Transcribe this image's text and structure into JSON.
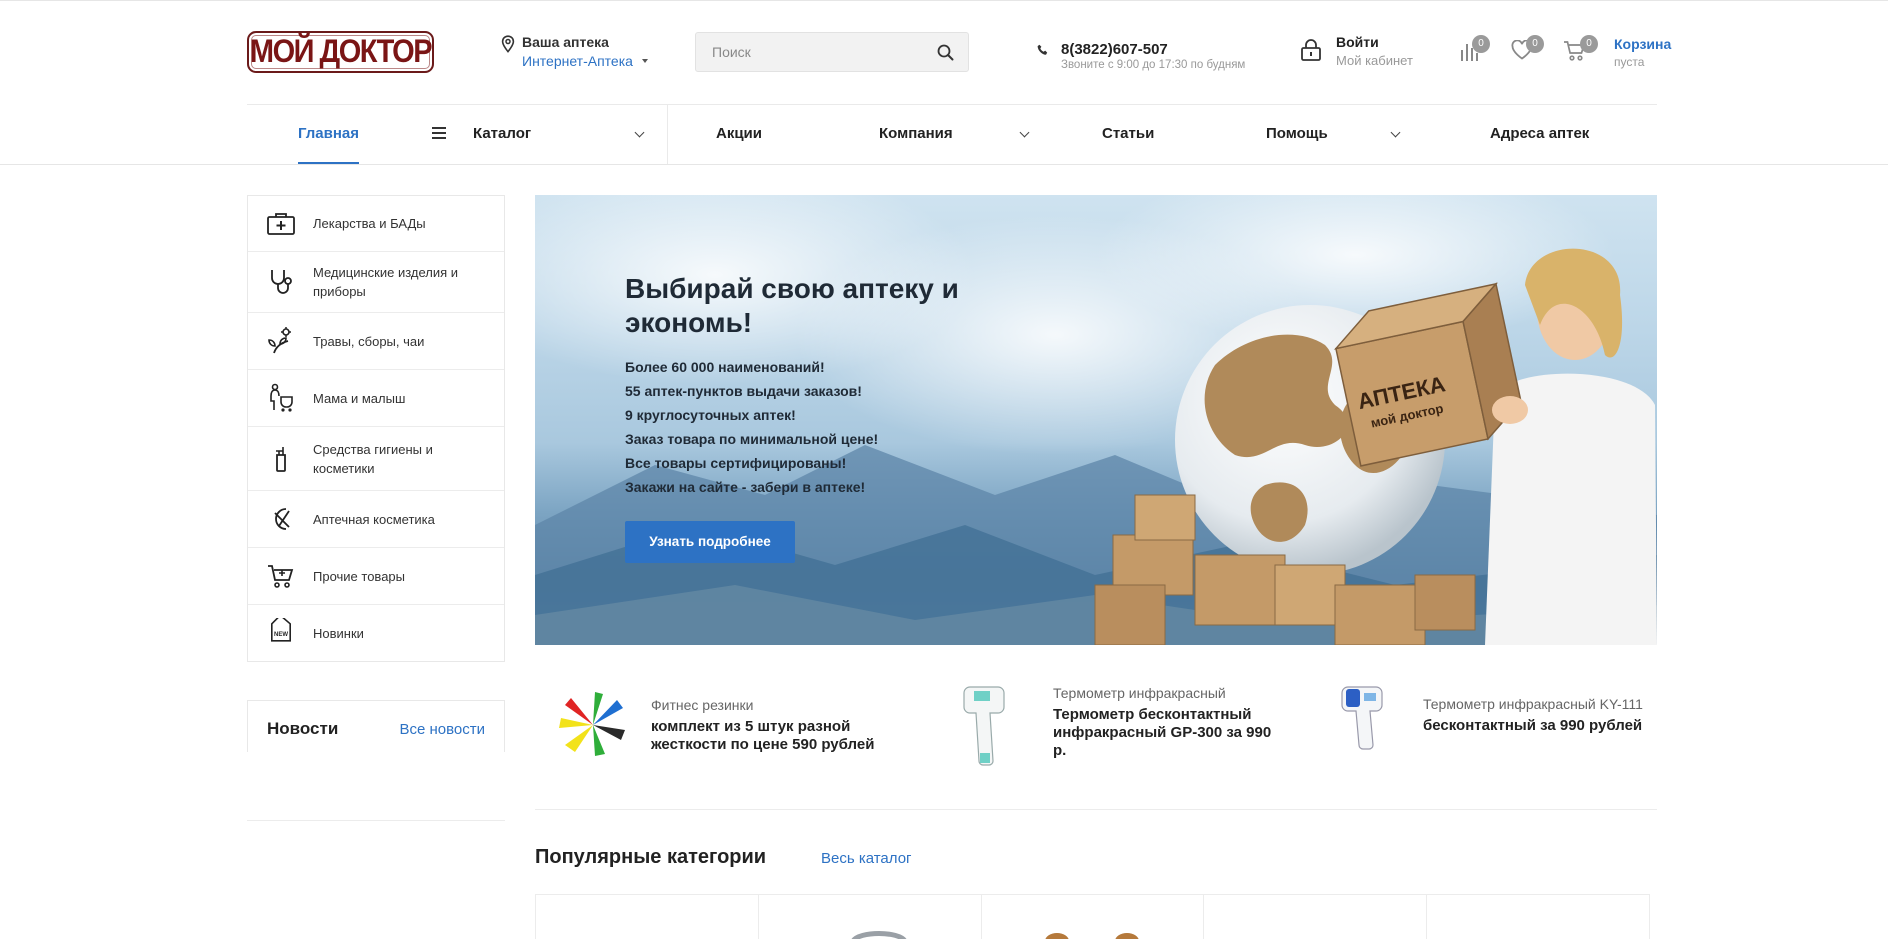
{
  "header": {
    "logo_text": "МОЙ ДОКТОР",
    "pharmacy_label": "Ваша аптека",
    "pharmacy_value": "Интернет-Аптека",
    "search_placeholder": "Поиск",
    "phone_number": "8(3822)607-507",
    "phone_hint": "Звоните с 9:00 до 17:30 по будням",
    "login_title": "Войти",
    "login_subtitle": "Мой кабинет",
    "compare_count": "0",
    "favorites_count": "0",
    "cart_count": "0",
    "cart_title": "Корзина",
    "cart_status": "пуста"
  },
  "nav": {
    "home": "Главная",
    "catalog": "Каталог",
    "promotions": "Акции",
    "company": "Компания",
    "articles": "Статьи",
    "help": "Помощь",
    "addresses": "Адреса аптек"
  },
  "sidebar": {
    "items": [
      {
        "label": "Лекарства и БАДы",
        "icon": "first-aid-kit-icon"
      },
      {
        "label": "Медицинские изделия и приборы",
        "icon": "stethoscope-icon"
      },
      {
        "label": "Травы, сборы, чаи",
        "icon": "herbs-icon"
      },
      {
        "label": "Мама и малыш",
        "icon": "mother-stroller-icon"
      },
      {
        "label": "Средства гигиены и косметики",
        "icon": "soap-dispenser-icon"
      },
      {
        "label": "Аптечная косметика",
        "icon": "cosmetics-icon"
      },
      {
        "label": "Прочие товары",
        "icon": "cart-icon"
      },
      {
        "label": "Новинки",
        "icon": "new-tag-icon"
      }
    ]
  },
  "news": {
    "title": "Новости",
    "all_link": "Все новости"
  },
  "banner": {
    "title_line1": "Выбирай свою аптеку и",
    "title_line2": "экономь!",
    "lines": [
      "Более 60 000 наименований!",
      "55 аптек-пунктов выдачи заказов!",
      "9 круглосуточных аптек!",
      "Заказ товара по минимальной цене!",
      "Все товары сертифицированы!",
      "Закажи на сайте - забери в аптеке!"
    ],
    "button": "Узнать подробнее",
    "box_text_line1": "АПТЕКА",
    "box_text_line2": "мой доктор"
  },
  "promos": [
    {
      "subtitle": "Фитнес резинки",
      "title_line1": "комплект из 5 штук разной",
      "title_line2": "жесткости по цене 590 рублей",
      "title_line3": ""
    },
    {
      "subtitle": "Термометр инфракрасный",
      "title_line1": "Термометр бесконтактный",
      "title_line2": "инфракрасный GP-300 за 990",
      "title_line3": "р."
    },
    {
      "subtitle": "Термометр инфракрасный KY-111",
      "title_line1": "бесконтактный за 990 рублей",
      "title_line2": "",
      "title_line3": ""
    }
  ],
  "popular": {
    "title": "Популярные категории",
    "all_link": "Весь каталог"
  },
  "colors": {
    "accent": "#2d72c4",
    "logo": "#7a1515",
    "badge": "#9a9a9a"
  }
}
